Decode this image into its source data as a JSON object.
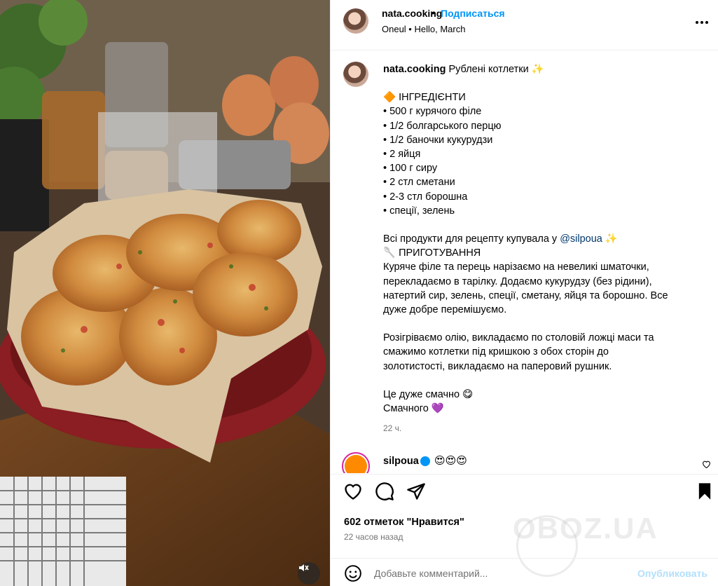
{
  "header": {
    "username": "nata.cooking",
    "separator": "•",
    "follow_label": "Подписаться",
    "audio": "Oneul • Hello, March",
    "more_icon": "more-dots-icon"
  },
  "caption": {
    "username": "nata.cooking",
    "title": "Рублені котлетки ✨",
    "ingredients_header": "🔶 ІНГРЕДІЄНТИ",
    "ingredients": [
      "• 500 г курячого філе",
      "• 1/2 болгарського перцю",
      "• 1/2 баночки кукурудзи",
      "• 2 яйця",
      "• 100 г сиру",
      "• 2 стл сметани",
      "• 2-3 стл борошна",
      "• спеції, зелень"
    ],
    "bought_prefix": "Всі продукти для рецепту купувала у ",
    "bought_mention": "@silpoua",
    "bought_suffix": " ✨",
    "prep_header": "🥄 ПРИГОТУВАННЯ",
    "prep_p1": [
      "Куряче філе та перець нарізаємо на невеликі шматочки,",
      "перекладаємо в тарілку. Додаємо кукурудзу (без рідини),",
      "натертий сир, зелень, спеції, сметану, яйця та борошно. Все",
      "дуже добре перемішуємо."
    ],
    "prep_p2": [
      "Розігріваємо олію, викладаємо по столовій ложці маси та",
      "смажимо котлетки під кришкою з обох сторін до",
      "золотистості, викладаємо на паперовий рушник."
    ],
    "closing": [
      "Це дуже смачно 😋",
      "Смачного 💜"
    ],
    "time": "22 ч."
  },
  "comment": {
    "username": "silpoua",
    "text": "😍😍😍"
  },
  "actions": {
    "likes": "602 отметок \"Нравится\"",
    "time_ago": "22 часов назад"
  },
  "add_comment": {
    "placeholder": "Добавьте комментарий...",
    "post_label": "Опубликовать"
  },
  "watermark": "OBOZ.UA",
  "colors": {
    "accent": "#0095f6",
    "mention": "#00376b",
    "muted": "#737373",
    "post_disabled": "#b2dffc"
  }
}
